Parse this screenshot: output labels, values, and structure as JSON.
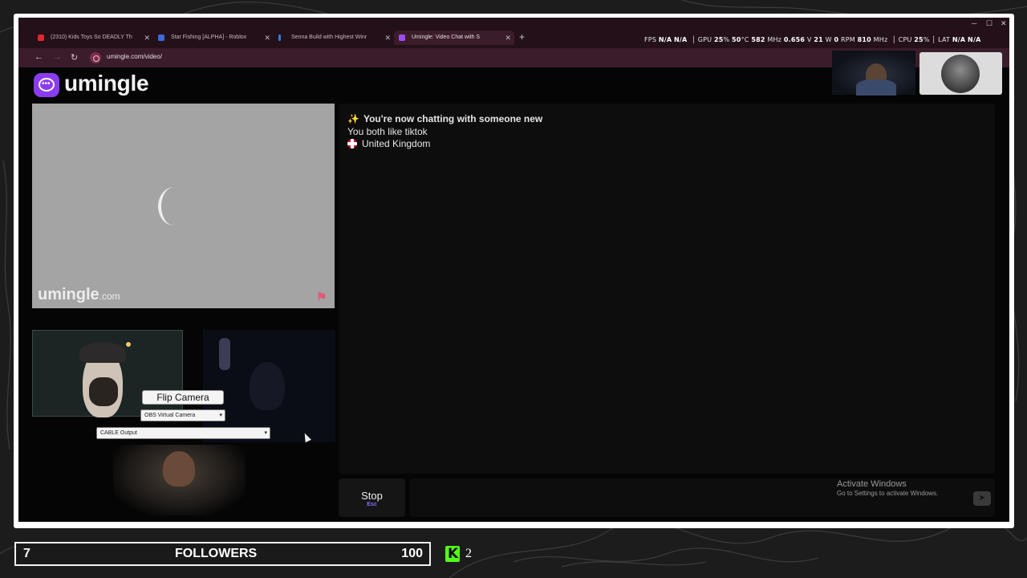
{
  "browser": {
    "tabs": [
      {
        "label": "(2310) Kids Toys So DEADLY Th",
        "favicon_color": "#e0262e"
      },
      {
        "label": "Star Fishing [ALPHA] - Roblox",
        "favicon_color": "#3a6ad8"
      },
      {
        "label": "Senna Build with Highest Winr",
        "favicon_color": "#2f7fd6"
      },
      {
        "label": "Umingle: Video Chat with S",
        "favicon_color": "#9b4df5",
        "active": true
      }
    ],
    "url": "umingle.com/video/"
  },
  "overlay_stats": {
    "fps_label": "FPS",
    "fps_value": "N/A",
    "fps_value2": "N/A",
    "gpu_label": "GPU",
    "gpu_load": "25",
    "gpu_temp": "50",
    "gpu_clock": "582",
    "gpu_voltage": "0.656",
    "gpu_power": "21",
    "gpu_mem": "0",
    "gpu_mem_clock": "810",
    "cpu_label": "CPU",
    "cpu_load": "25",
    "lat_label": "LAT",
    "lat_value": "N/A",
    "lat_value2": "N/A"
  },
  "app": {
    "name": "umingle",
    "logo_color": "#8b3cf0",
    "watermark": "umingle",
    "watermark_suffix": ".com"
  },
  "chat": {
    "messages": [
      {
        "text": "You're now chatting with someone new",
        "icon": "sparkle-icon"
      },
      {
        "text": "You both like tiktok"
      },
      {
        "text": "United Kingdom",
        "icon": "uk-flag-icon"
      }
    ]
  },
  "controls": {
    "flip_camera_label": "Flip Camera",
    "camera_select_value": "OBS Virtual Camera",
    "audio_select_value": "CABLE Output",
    "stop_label": "Stop",
    "stop_hint": "Esc",
    "accent_color": "#8a6dff"
  },
  "windows_notice": {
    "title": "Activate Windows",
    "subtitle": "Go to Settings to activate Windows."
  },
  "follower_goal": {
    "current": "7",
    "label": "FOLLOWERS",
    "target": "100"
  },
  "kick": {
    "count": "2",
    "color": "#53fc18"
  }
}
